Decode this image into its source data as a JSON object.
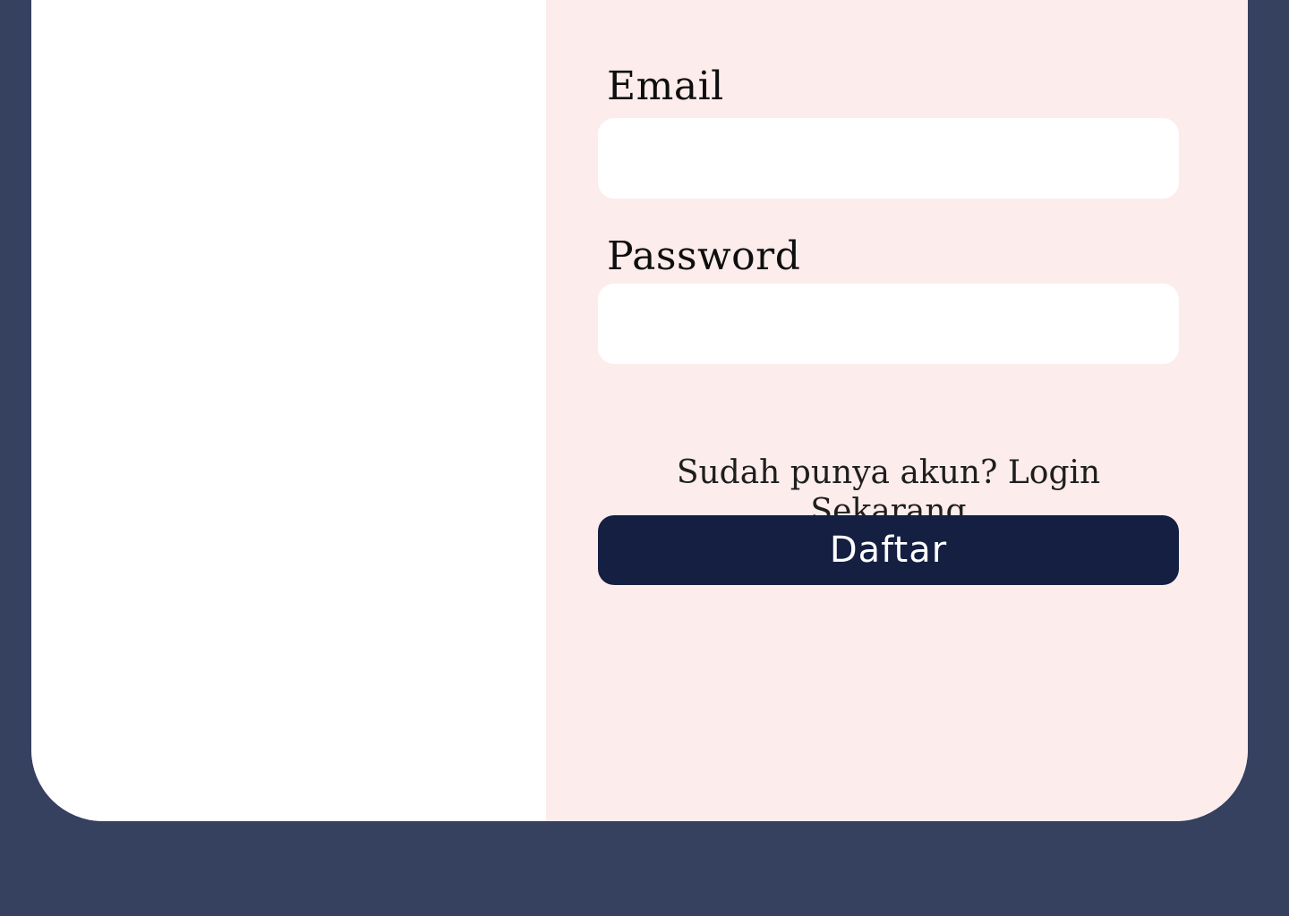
{
  "form": {
    "email_label": "Email",
    "email_value": "",
    "password_label": "Password",
    "password_value": "",
    "prompt_text": "Sudah punya akun?",
    "login_link": "Login Sekarang",
    "submit_label": "Daftar"
  },
  "colors": {
    "page_background": "#36405F",
    "left_panel": "#FFFFFF",
    "right_panel": "#FCECEC",
    "button": "#141F42",
    "button_text": "#FFFFFF"
  }
}
